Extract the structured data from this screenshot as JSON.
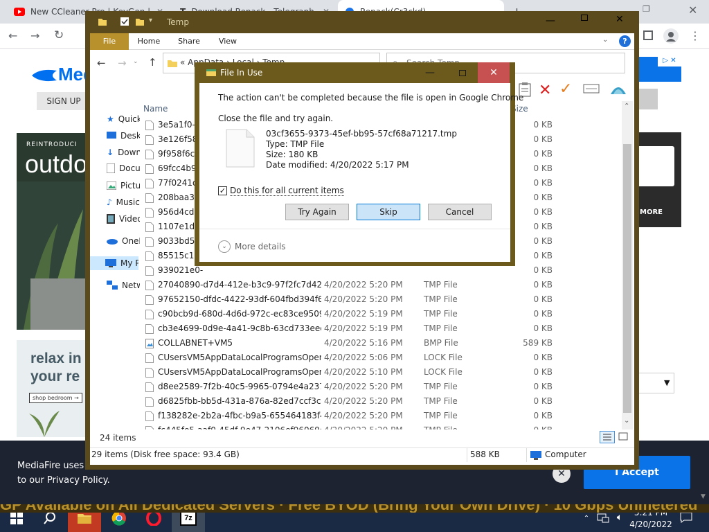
{
  "browser": {
    "tabs": [
      {
        "title": "New CCleaner Pro | KeyGen | Ko"
      },
      {
        "title": "Download Repack - Telegraph"
      },
      {
        "title": "Repack(Cr3ckd)"
      }
    ]
  },
  "webpage": {
    "logo": "Media",
    "signup": "SIGN UP",
    "promo1_small": "REINTRODUCI",
    "promo1_big": "outdo",
    "promo2_line1": "relax in",
    "promo2_line2": "your re",
    "promo2_link": "shop bedroom →",
    "right_card_more": "MORE",
    "cookie_msg_line1": "MediaFire uses cookie",
    "cookie_msg_line2": "to our Privacy Policy.",
    "accept": "I Accept",
    "ticker": "GP Available on All Dedicated Servers · Free BYOD (Bring Your Own Drive) · 10 Gbps Unmetered"
  },
  "explorer": {
    "title": "Temp",
    "ribbon_tabs": [
      "File",
      "Home",
      "Share",
      "View"
    ],
    "address": [
      "AppData",
      "Local",
      "Temp"
    ],
    "search_placeholder": "Search Temp",
    "col_name": "Name",
    "col_size": "Size",
    "nav": [
      {
        "label": "Quick access",
        "icon": "star-icon"
      },
      {
        "label": "Desktop",
        "icon": "desktop-icon"
      },
      {
        "label": "Downloads",
        "icon": "download-icon"
      },
      {
        "label": "Documents",
        "icon": "documents-icon"
      },
      {
        "label": "Pictures",
        "icon": "pictures-icon"
      },
      {
        "label": "Music",
        "icon": "music-icon"
      },
      {
        "label": "Videos",
        "icon": "videos-icon"
      },
      {
        "label": "OneDrive",
        "icon": "cloud-icon"
      },
      {
        "label": "My PC",
        "icon": "pc-icon"
      },
      {
        "label": "Network",
        "icon": "network-icon"
      }
    ],
    "files": [
      {
        "name": "3e5a1f0-",
        "date": "",
        "type": "",
        "size": "0 KB"
      },
      {
        "name": "3e126f58-f",
        "date": "",
        "type": "",
        "size": "0 KB"
      },
      {
        "name": "9f958f6c-4",
        "date": "",
        "type": "",
        "size": "0 KB"
      },
      {
        "name": "69fcc4b9-",
        "date": "",
        "type": "",
        "size": "0 KB"
      },
      {
        "name": "77f0241d-",
        "date": "",
        "type": "",
        "size": "0 KB"
      },
      {
        "name": "208baa35-",
        "date": "",
        "type": "",
        "size": "0 KB"
      },
      {
        "name": "956d4cd6-",
        "date": "",
        "type": "",
        "size": "0 KB"
      },
      {
        "name": "1107e1dd-",
        "date": "",
        "type": "",
        "size": "0 KB"
      },
      {
        "name": "9033bd5f-",
        "date": "",
        "type": "",
        "size": "0 KB"
      },
      {
        "name": "85515c17-",
        "date": "",
        "type": "",
        "size": "0 KB"
      },
      {
        "name": "939021e0-",
        "date": "",
        "type": "",
        "size": "0 KB"
      },
      {
        "name": "27040890-d7d4-412e-b3c9-97f2fc7d4204...",
        "date": "4/20/2022 5:20 PM",
        "type": "TMP File",
        "size": "0 KB"
      },
      {
        "name": "97652150-dfdc-4422-93df-604fbd394f6e.t...",
        "date": "4/20/2022 5:20 PM",
        "type": "TMP File",
        "size": "0 KB"
      },
      {
        "name": "c90bcb9d-680d-4d6d-972c-ec83ce95098...",
        "date": "4/20/2022 5:19 PM",
        "type": "TMP File",
        "size": "0 KB"
      },
      {
        "name": "cb3e4699-0d9e-4a41-9c8b-63cd733eec3c...",
        "date": "4/20/2022 5:19 PM",
        "type": "TMP File",
        "size": "0 KB"
      },
      {
        "name": "COLLABNET+VM5",
        "date": "4/20/2022 5:16 PM",
        "type": "BMP File",
        "size": "589 KB"
      },
      {
        "name": "CUsersVM5AppDataLocalProgramsOpera...",
        "date": "4/20/2022 5:06 PM",
        "type": "LOCK File",
        "size": "0 KB"
      },
      {
        "name": "CUsersVM5AppDataLocalProgramsOpera...",
        "date": "4/20/2022 5:10 PM",
        "type": "LOCK File",
        "size": "0 KB"
      },
      {
        "name": "d8ee2589-7f2b-40c5-9965-0794e4a2375b...",
        "date": "4/20/2022 5:20 PM",
        "type": "TMP File",
        "size": "0 KB"
      },
      {
        "name": "d6825fbb-bb5d-431a-876a-82ed7ccf3cc2...",
        "date": "4/20/2022 5:20 PM",
        "type": "TMP File",
        "size": "0 KB"
      },
      {
        "name": "f138282e-2b2a-4fbc-b9a5-655464183f4e.t...",
        "date": "4/20/2022 5:20 PM",
        "type": "TMP File",
        "size": "0 KB"
      },
      {
        "name": "fc445fe5-aaf0-45df-9e47-2106ef96069e.t...",
        "date": "4/20/2022 5:20 PM",
        "type": "TMP File",
        "size": "0 KB"
      }
    ],
    "items_count": "24 items",
    "status_items": "29 items (Disk free space: 93.4 GB)",
    "status_size": "588 KB",
    "status_location": "Computer"
  },
  "dialog": {
    "title": "File In Use",
    "message": "The action can't be completed because the file is open in Google Chrome",
    "instruction": "Close the file and try again.",
    "file_name": "03cf3655-9373-45ef-bb95-57cf68a71217.tmp",
    "file_type": "Type: TMP File",
    "file_size": "Size: 180 KB",
    "file_modified": "Date modified: 4/20/2022 5:17 PM",
    "checkbox_label": "Do this for all current items",
    "checkbox_checked": true,
    "btn_try_again": "Try Again",
    "btn_skip": "Skip",
    "btn_cancel": "Cancel",
    "more_details": "More details"
  },
  "taskbar": {
    "time": "5:21 PM",
    "date": "4/20/2022"
  },
  "colors": {
    "explorer_frame": "#5a4a1c",
    "ribbon_file": "#b8912d",
    "taskbar": "#1b2a44",
    "accept_blue": "#0a73e8"
  }
}
